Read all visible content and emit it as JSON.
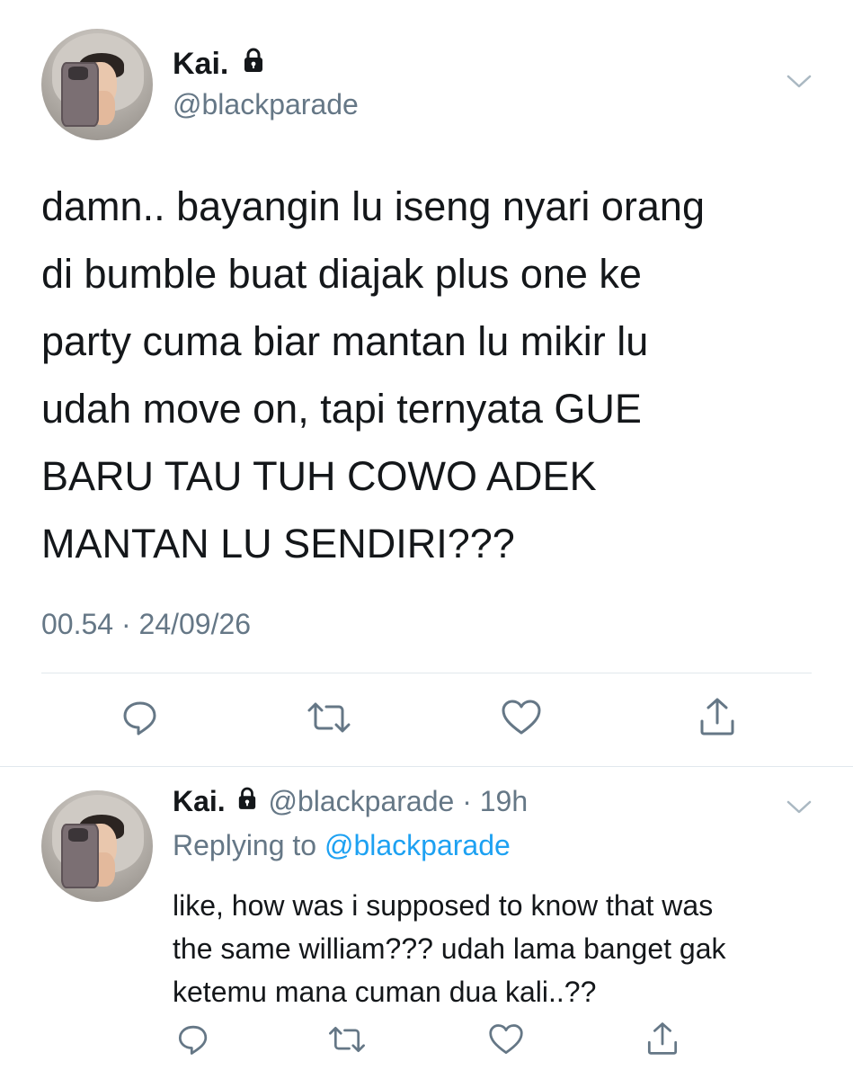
{
  "main_tweet": {
    "name": "Kai.",
    "handle": "@blackparade",
    "text": "damn.. bayangin lu iseng nyari orang\ndi bumble buat diajak plus one ke\nparty cuma biar mantan lu mikir lu\nudah move on, tapi ternyata GUE\nBARU TAU TUH COWO ADEK\nMANTAN LU SENDIRI???",
    "timestamp": "00.54 · 24/09/26"
  },
  "reply_tweet": {
    "name": "Kai.",
    "handle": "@blackparade",
    "time": "· 19h",
    "replying_prefix": "Replying to",
    "replying_to": "@blackparade",
    "text": "like, how was i supposed to know that was\nthe same william??? udah lama banget gak\nketemu mana cuman dua kali..??"
  },
  "icons": [
    "lock-icon",
    "chevron-down-icon",
    "reply-icon",
    "retweet-icon",
    "like-icon",
    "share-icon"
  ],
  "colors": {
    "text": "#14171a",
    "secondary": "#657786",
    "link": "#1da1f2",
    "divider": "#e1e8ed"
  }
}
